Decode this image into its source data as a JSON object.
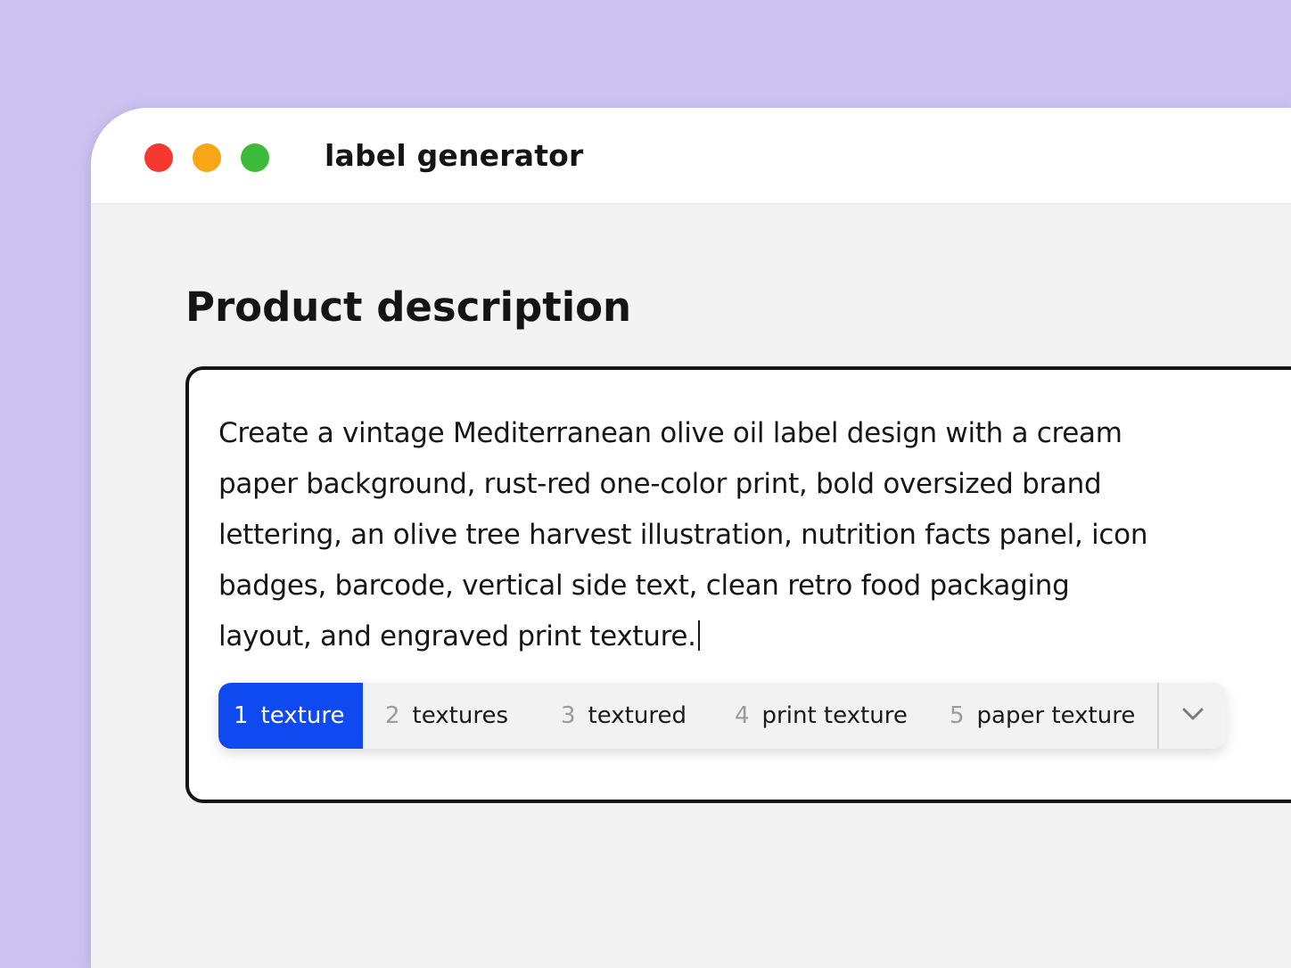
{
  "window": {
    "title": "label generator",
    "controls": [
      "close",
      "minimize",
      "maximize"
    ],
    "control_colors": {
      "close": "#f6392f",
      "minimize": "#f8a516",
      "maximize": "#3cba3a"
    }
  },
  "main": {
    "heading": "Product description",
    "description_text": "Create a vintage Mediterranean olive oil label design with a cream paper background, rust-red one-color print, bold oversized brand lettering, an olive tree harvest illustration, nutrition facts panel, icon badges, barcode, vertical side text, clean retro food packaging layout, and engraved print texture."
  },
  "suggestions": {
    "items": [
      {
        "number": "1",
        "text": "texture",
        "selected": true
      },
      {
        "number": "2",
        "text": "textures",
        "selected": false
      },
      {
        "number": "3",
        "text": "textured",
        "selected": false
      },
      {
        "number": "4",
        "text": "print texture",
        "selected": false
      },
      {
        "number": "5",
        "text": "paper texture",
        "selected": false
      }
    ],
    "expand_icon": "chevron-down-icon",
    "selected_color": "#0f49f0"
  },
  "colors": {
    "background": "#cdc3f1",
    "window_body": "#f3f3f4",
    "text": "#161616"
  }
}
